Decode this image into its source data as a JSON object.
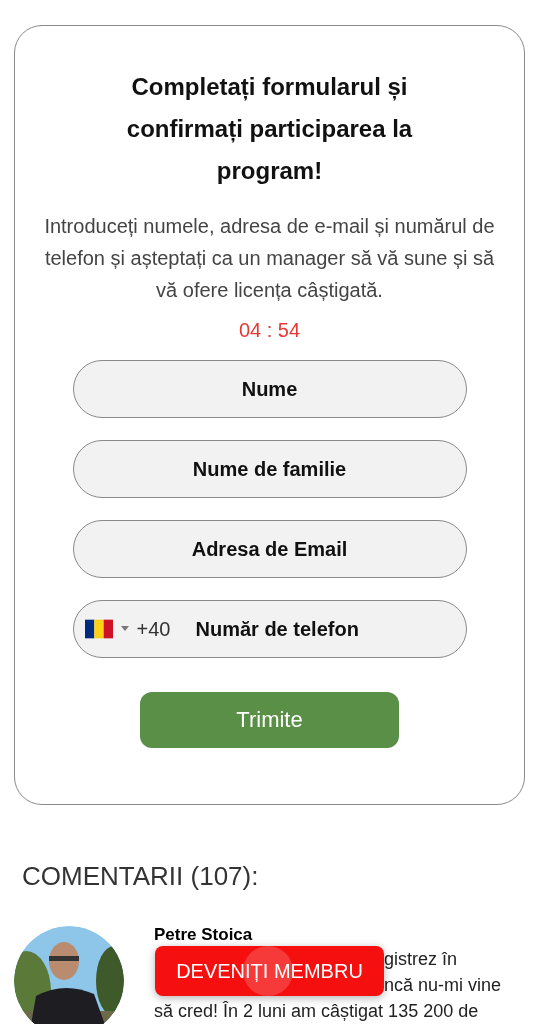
{
  "form": {
    "title": "Completați formularul și confirmați participarea la program!",
    "description": "Introduceți numele, adresa de e-mail și numărul de telefon și așteptați ca un manager să vă sune și să vă ofere licența câștigată.",
    "timer": "04 : 54",
    "fields": [
      {
        "kind": "text",
        "placeholder": "Nume"
      },
      {
        "kind": "text",
        "placeholder": "Nume de familie"
      },
      {
        "kind": "text",
        "placeholder": "Adresa de Email"
      },
      {
        "kind": "phone",
        "dial_code": "+40",
        "placeholder": "Număr de telefon"
      }
    ],
    "submit": "Trimite"
  },
  "comments": {
    "heading": "COMENTARII (107):",
    "items": [
      {
        "author": "Petre Stoica",
        "avatar": {
          "kind": "picture"
        },
        "lines": [
          "gistrez în",
          "ncă nu-mi vine",
          "să cred! În 2 luni am câștigat 135 200 de"
        ]
      }
    ]
  },
  "floating_button": "DEVENIȚI MEMBRU"
}
